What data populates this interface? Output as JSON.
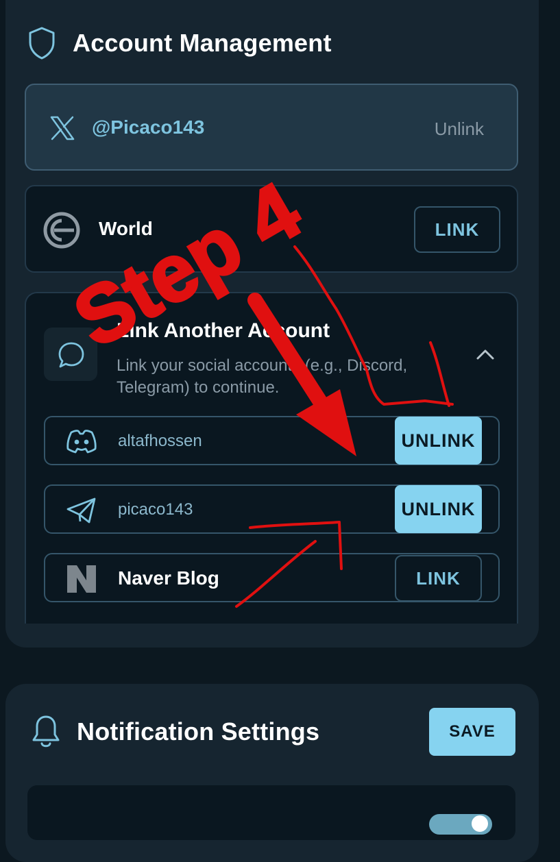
{
  "account_management": {
    "title": "Account Management",
    "linked_x": {
      "handle": "@Picaco143",
      "action": "Unlink"
    },
    "world": {
      "name": "World",
      "action": "LINK"
    },
    "link_another": {
      "title": "Link Another Account",
      "description_line1": "Link your social accounts (e.g., Discord,",
      "description_line2": "Telegram) to continue."
    },
    "sub_accounts": [
      {
        "icon": "discord-icon",
        "name": "altafhossen",
        "action": "UNLINK"
      },
      {
        "icon": "telegram-icon",
        "name": "picaco143",
        "action": "UNLINK"
      },
      {
        "icon": "naver-icon",
        "name": "Naver Blog",
        "action": "LINK"
      }
    ]
  },
  "annotation": {
    "text": "Step 4",
    "color": "#e01010"
  },
  "notification_settings": {
    "title": "Notification Settings",
    "save_label": "SAVE"
  },
  "colors": {
    "accent": "#86d3f0",
    "background": "#0c1820",
    "card": "#162530",
    "annotation": "#e01010"
  }
}
